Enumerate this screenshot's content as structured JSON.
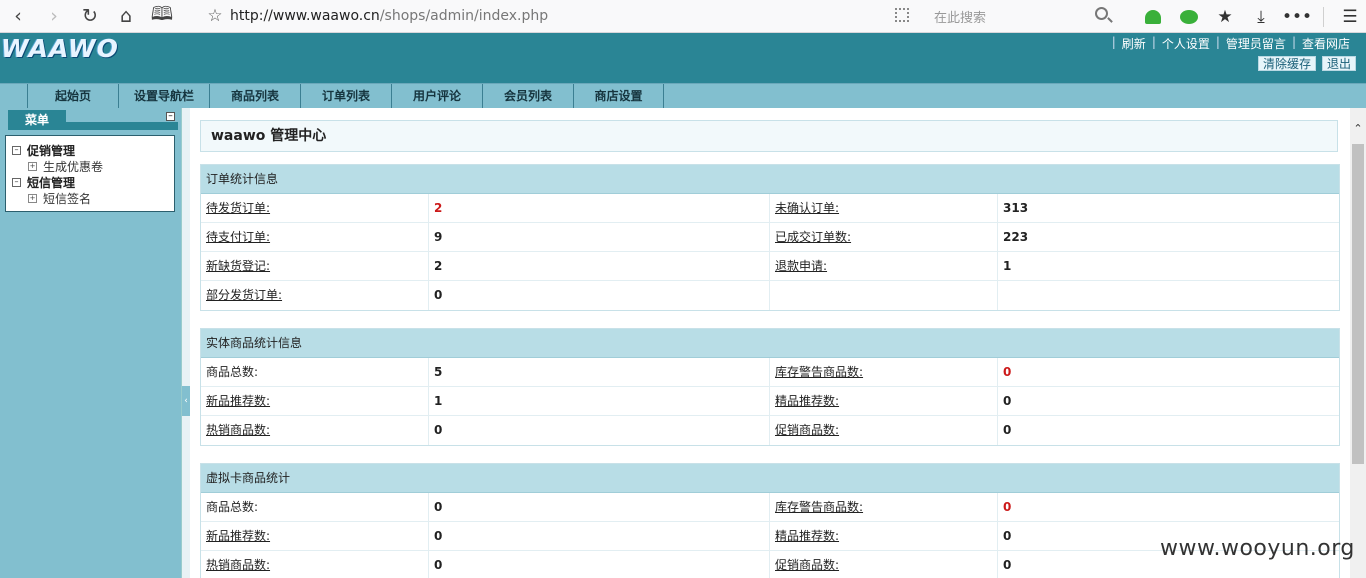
{
  "browser": {
    "url_host": "http://www.waawo.cn",
    "url_path": "/shops/admin/index.php",
    "search_placeholder": "在此搜索"
  },
  "header": {
    "logo": "WAAWO",
    "links": [
      "刷新",
      "个人设置",
      "管理员留言",
      "查看网店"
    ],
    "buttons": [
      "清除缓存",
      "退出"
    ]
  },
  "menu": {
    "tabs": [
      "起始页",
      "设置导航栏",
      "商品列表",
      "订单列表",
      "用户评论",
      "会员列表",
      "商店设置"
    ]
  },
  "sidebar": {
    "title": "菜单",
    "groups": [
      {
        "label": "促销管理",
        "items": [
          "生成优惠卷"
        ]
      },
      {
        "label": "短信管理",
        "items": [
          "短信签名"
        ]
      }
    ]
  },
  "main": {
    "title": "waawo 管理中心",
    "sections": [
      {
        "title": "订单统计信息",
        "rows": [
          [
            "待发货订单:",
            "2",
            "未确认订单:",
            "313"
          ],
          [
            "待支付订单:",
            "9",
            "已成交订单数:",
            "223"
          ],
          [
            "新缺货登记:",
            "2",
            "退款申请:",
            "1"
          ],
          [
            "部分发货订单:",
            "0",
            "",
            ""
          ]
        ]
      },
      {
        "title": "实体商品统计信息",
        "rows": [
          [
            "商品总数:",
            "5",
            "库存警告商品数:",
            "0"
          ],
          [
            "新品推荐数:",
            "1",
            "精品推荐数:",
            "0"
          ],
          [
            "热销商品数:",
            "0",
            "促销商品数:",
            "0"
          ]
        ]
      },
      {
        "title": "虚拟卡商品统计",
        "rows": [
          [
            "商品总数:",
            "0",
            "库存警告商品数:",
            "0"
          ],
          [
            "新品推荐数:",
            "0",
            "精品推荐数:",
            "0"
          ],
          [
            "热销商品数:",
            "0",
            "促销商品数:",
            "0"
          ]
        ]
      }
    ]
  },
  "watermark": "www.wooyun.org",
  "colors": {
    "header_bg": "#2a8595",
    "menubar_bg": "#82bfcf",
    "section_head_bg": "#b8dde6",
    "alert_red": "#cc1a1a"
  }
}
